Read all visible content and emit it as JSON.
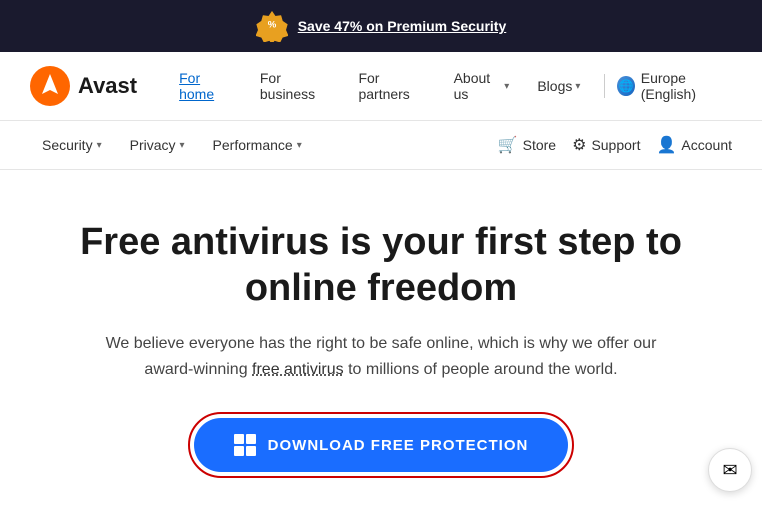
{
  "banner": {
    "text": "Save 47% on Premium Security",
    "badge_symbol": "%"
  },
  "main_nav": {
    "logo": "Avast",
    "links": [
      {
        "label": "For home",
        "active": true
      },
      {
        "label": "For business",
        "active": false
      },
      {
        "label": "For partners",
        "active": false
      },
      {
        "label": "About us",
        "has_chevron": true
      },
      {
        "label": "Blogs",
        "has_chevron": true
      }
    ],
    "region": "Europe (English)"
  },
  "secondary_nav": {
    "items": [
      {
        "label": "Security",
        "has_chevron": true
      },
      {
        "label": "Privacy",
        "has_chevron": true
      },
      {
        "label": "Performance",
        "has_chevron": true
      }
    ],
    "right_items": [
      {
        "label": "Store",
        "icon": "cart"
      },
      {
        "label": "Support",
        "icon": "gear"
      },
      {
        "label": "Account",
        "icon": "person"
      }
    ]
  },
  "hero": {
    "heading_line1": "Free antivirus is your first step to",
    "heading_line2": "online freedom",
    "body": "We believe everyone has the right to be safe online, which is why we offer our award-winning ",
    "link_text": "free antivirus",
    "body_end": " to millions of people around the world.",
    "cta_label": "DOWNLOAD FREE PROTECTION"
  },
  "chat": {
    "icon": "✉"
  }
}
